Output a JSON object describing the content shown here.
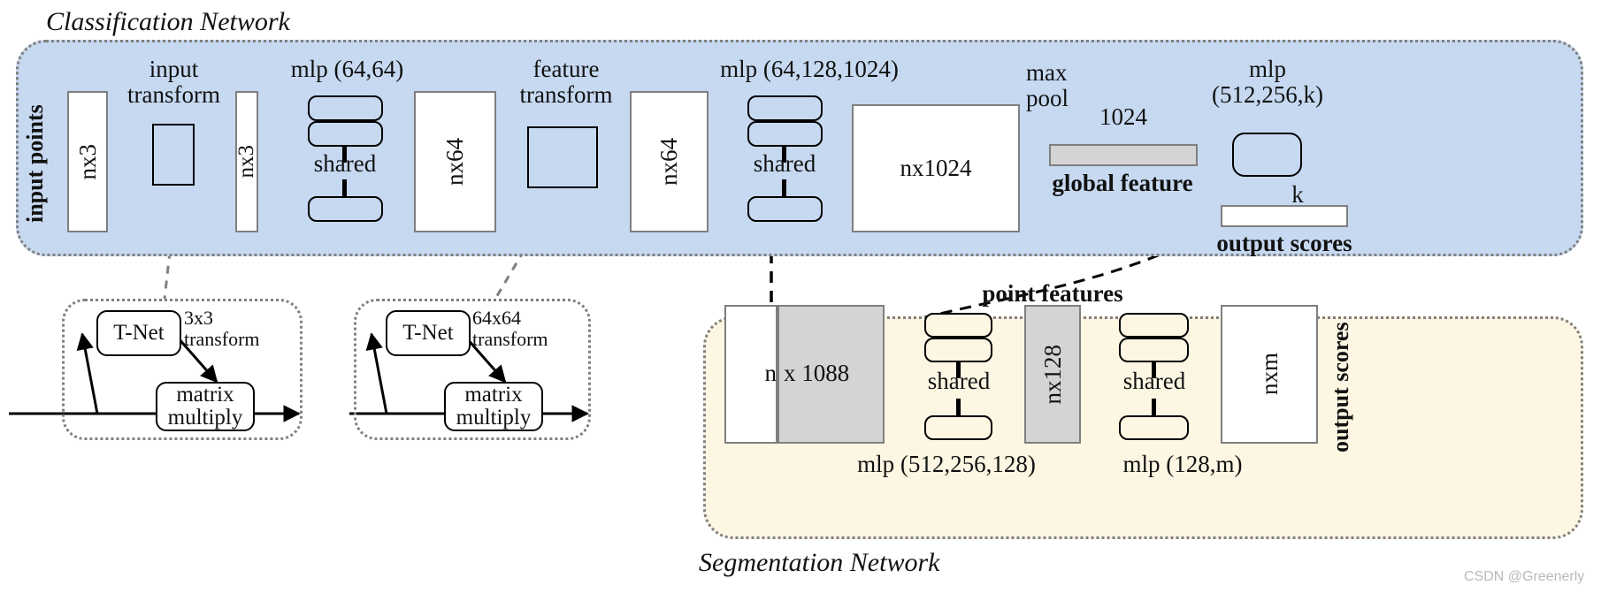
{
  "figure": {
    "classification_caption": "Classification Network",
    "segmentation_caption": "Segmentation Network",
    "watermark": "CSDN @Greenerly"
  },
  "classification": {
    "input_points_label": "input points",
    "input_tensor_1": "nx3",
    "input_transform_label": "input\ntransform",
    "input_transform_line1": "input",
    "input_transform_line2": "transform",
    "transformed_tensor": "nx3",
    "mlp1_label": "mlp (64,64)",
    "shared1_label": "shared",
    "feat_tensor_64a": "nx64",
    "feature_transform_line1": "feature",
    "feature_transform_line2": "transform",
    "feat_tensor_64b": "nx64",
    "mlp2_label": "mlp (64,128,1024)",
    "shared2_label": "shared",
    "feat_tensor_1024": "nx1024",
    "maxpool_line1": "max",
    "maxpool_line2": "pool",
    "global_dim": "1024",
    "global_feature_label": "global feature",
    "mlp3_line1": "mlp",
    "mlp3_line2": "(512,256,k)",
    "k_label": "k",
    "output_scores_label": "output scores"
  },
  "tnet_input": {
    "tnet_label": "T-Net",
    "transform_line1": "3x3",
    "transform_line2": "transform",
    "matrix_line1": "matrix",
    "matrix_line2": "multiply"
  },
  "tnet_feature": {
    "tnet_label": "T-Net",
    "transform_line1": "64x64",
    "transform_line2": "transform",
    "matrix_line1": "matrix",
    "matrix_line2": "multiply"
  },
  "segmentation": {
    "concat_n": "n",
    "concat_dim": "x 1088",
    "point_features_label": "point features",
    "shared1_label": "shared",
    "shared2_label": "shared",
    "feat_tensor_128": "nx128",
    "mlp_seg1_label": "mlp (512,256,128)",
    "mlp_seg2_label": "mlp (128,m)",
    "output_tensor": "nxm",
    "output_scores_label": "output scores"
  }
}
